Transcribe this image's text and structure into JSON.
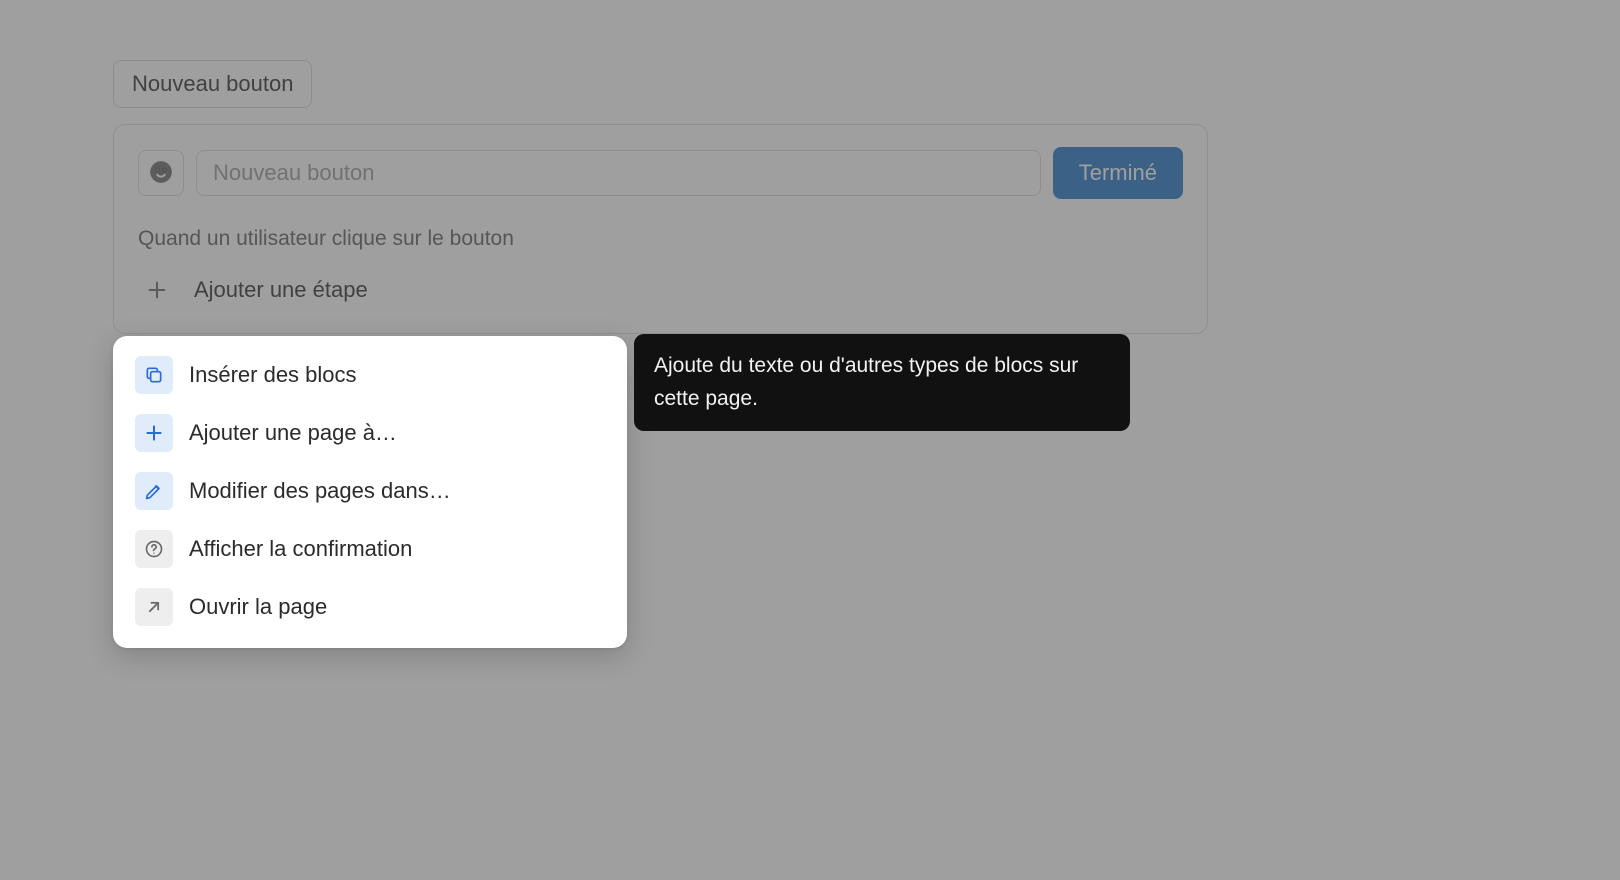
{
  "badge": {
    "label": "Nouveau bouton"
  },
  "panel": {
    "title_placeholder": "Nouveau bouton",
    "done_label": "Terminé",
    "section_label": "Quand un utilisateur clique sur le bouton",
    "add_step_label": "Ajouter une étape"
  },
  "menu": {
    "items": [
      {
        "icon": "copy",
        "label": "Insérer des blocs",
        "active": true
      },
      {
        "icon": "plus",
        "label": "Ajouter une page à…"
      },
      {
        "icon": "pencil",
        "label": "Modifier des pages dans…"
      },
      {
        "icon": "help",
        "label": "Afficher la confirmation"
      },
      {
        "icon": "arrow",
        "label": "Ouvrir la page"
      }
    ]
  },
  "tooltip": {
    "text": "Ajoute du texte ou d'autres types de blocs sur cette page."
  }
}
